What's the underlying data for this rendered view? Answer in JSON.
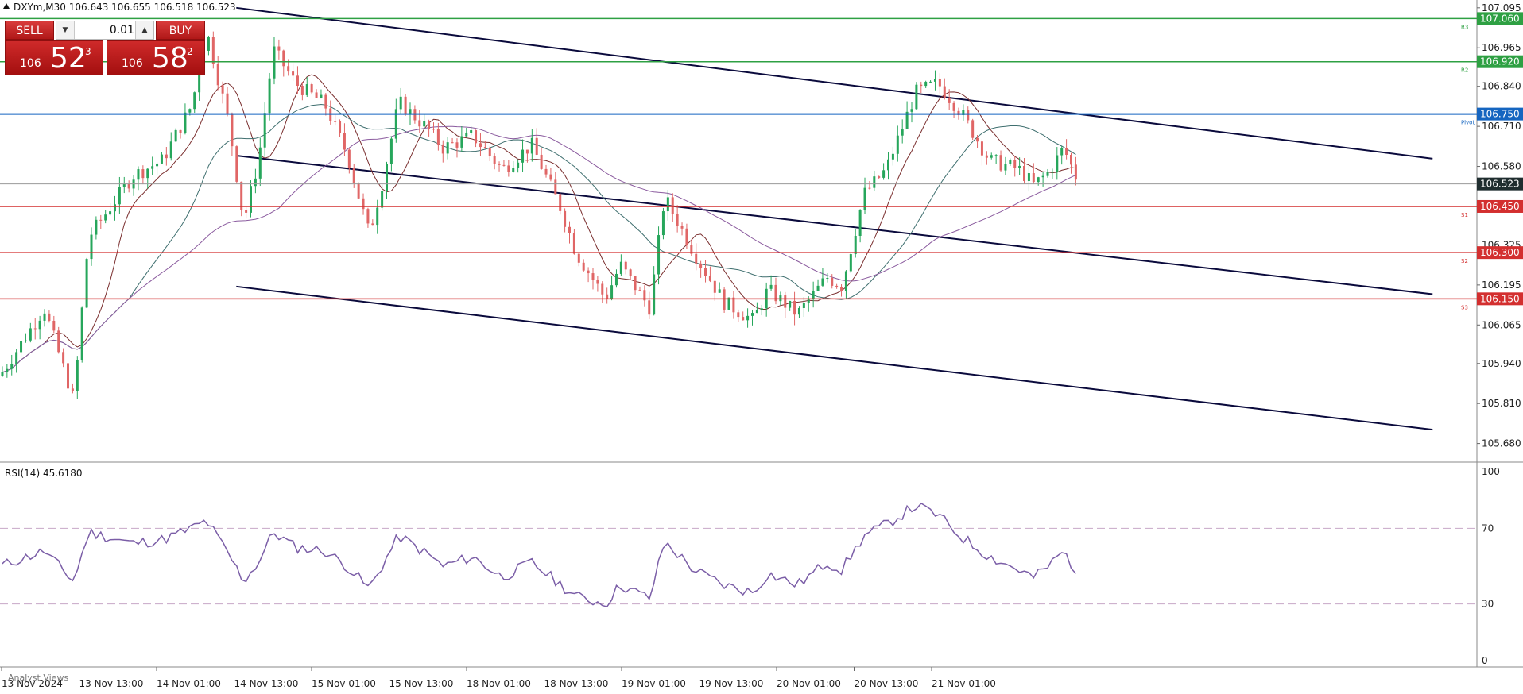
{
  "header": {
    "symbol_text": "DXYm,M30  106.643 106.655 106.518 106.523"
  },
  "trade_panel": {
    "sell_label": "SELL",
    "buy_label": "BUY",
    "lot_value": "0.01",
    "sell_price_small": "106",
    "sell_price_big": "52",
    "sell_price_sup": "3",
    "buy_price_small": "106",
    "buy_price_big": "58",
    "buy_price_sup": "2"
  },
  "colors": {
    "bull": "#26a65b",
    "bear": "#e06666",
    "resistance": "#2ea043",
    "support": "#d32f2f",
    "pivot": "#1565c0",
    "channel": "#0a0a3c",
    "rsi": "#7b5ea7"
  },
  "icons": {
    "sell_decrement": "caret-down-icon",
    "lot_increment": "caret-up-icon",
    "symbol_marker": "triangle-up-icon"
  },
  "chart_data": [
    {
      "type": "candlestick",
      "price_axis": {
        "ticks": [
          "107.095",
          "106.965",
          "106.840",
          "106.710",
          "106.580",
          "106.325",
          "106.195",
          "106.065",
          "105.940",
          "105.810",
          "105.680"
        ],
        "ylim": [
          105.63,
          107.11
        ]
      },
      "x_labels": [
        "13 Nov 2024",
        "13 Nov 13:00",
        "14 Nov 01:00",
        "14 Nov 13:00",
        "15 Nov 01:00",
        "15 Nov 13:00",
        "18 Nov 01:00",
        "18 Nov 13:00",
        "19 Nov 01:00",
        "19 Nov 13:00",
        "20 Nov 01:00",
        "20 Nov 13:00",
        "21 Nov 01:00"
      ],
      "levels": [
        {
          "label": "R3",
          "price": 107.06,
          "price_label": "107.060",
          "role": "resistance"
        },
        {
          "label": "R2",
          "price": 106.92,
          "price_label": "106.920",
          "role": "resistance"
        },
        {
          "label": "Pivot",
          "price": 106.75,
          "price_label": "106.750",
          "role": "pivot"
        },
        {
          "label": "S1",
          "price": 106.45,
          "price_label": "106.450",
          "role": "support"
        },
        {
          "label": "S2",
          "price": 106.3,
          "price_label": "106.300",
          "role": "support"
        },
        {
          "label": "S3",
          "price": 106.15,
          "price_label": "106.150",
          "role": "support"
        }
      ],
      "current_price": {
        "price": 106.523,
        "label": "106.523"
      },
      "channel_lines": [
        {
          "x0_bar": 0.16,
          "y0": 107.095,
          "x1_bar": 0.97,
          "y1": 106.605
        },
        {
          "x0_bar": 0.16,
          "y0": 106.615,
          "x1_bar": 0.97,
          "y1": 106.165
        },
        {
          "x0_bar": 0.16,
          "y0": 106.19,
          "x1_bar": 0.97,
          "y1": 105.725
        }
      ],
      "waypoints": [
        [
          0,
          105.9
        ],
        [
          0.03,
          106.12
        ],
        [
          0.05,
          105.82
        ],
        [
          0.06,
          106.35
        ],
        [
          0.09,
          106.55
        ],
        [
          0.11,
          106.6
        ],
        [
          0.13,
          106.78
        ],
        [
          0.14,
          107.02
        ],
        [
          0.155,
          106.72
        ],
        [
          0.165,
          106.4
        ],
        [
          0.175,
          106.6
        ],
        [
          0.185,
          106.96
        ],
        [
          0.2,
          106.85
        ],
        [
          0.22,
          106.78
        ],
        [
          0.235,
          106.62
        ],
        [
          0.25,
          106.36
        ],
        [
          0.26,
          106.55
        ],
        [
          0.27,
          106.79
        ],
        [
          0.29,
          106.7
        ],
        [
          0.3,
          106.64
        ],
        [
          0.32,
          106.68
        ],
        [
          0.34,
          106.57
        ],
        [
          0.36,
          106.65
        ],
        [
          0.38,
          106.44
        ],
        [
          0.39,
          106.3
        ],
        [
          0.41,
          106.15
        ],
        [
          0.42,
          106.26
        ],
        [
          0.44,
          106.12
        ],
        [
          0.45,
          106.48
        ],
        [
          0.47,
          106.3
        ],
        [
          0.49,
          106.14
        ],
        [
          0.51,
          106.08
        ],
        [
          0.52,
          106.18
        ],
        [
          0.54,
          106.1
        ],
        [
          0.56,
          106.22
        ],
        [
          0.57,
          106.19
        ],
        [
          0.585,
          106.49
        ],
        [
          0.6,
          106.57
        ],
        [
          0.62,
          106.82
        ],
        [
          0.635,
          106.85
        ],
        [
          0.65,
          106.76
        ],
        [
          0.67,
          106.6
        ],
        [
          0.69,
          106.57
        ],
        [
          0.7,
          106.52
        ],
        [
          0.71,
          106.56
        ],
        [
          0.72,
          106.64
        ],
        [
          0.73,
          106.53
        ]
      ]
    },
    {
      "type": "line",
      "title": "RSI(14) 45.6180",
      "ylim": [
        0,
        100
      ],
      "ticks": [
        "100",
        "70",
        "30",
        "0"
      ],
      "levels": [
        70,
        30
      ],
      "waypoints": [
        [
          0,
          50
        ],
        [
          0.03,
          58
        ],
        [
          0.05,
          42
        ],
        [
          0.06,
          68
        ],
        [
          0.09,
          62
        ],
        [
          0.11,
          64
        ],
        [
          0.13,
          70
        ],
        [
          0.14,
          74
        ],
        [
          0.155,
          56
        ],
        [
          0.165,
          42
        ],
        [
          0.175,
          52
        ],
        [
          0.185,
          68
        ],
        [
          0.2,
          60
        ],
        [
          0.22,
          58
        ],
        [
          0.235,
          50
        ],
        [
          0.25,
          38
        ],
        [
          0.26,
          52
        ],
        [
          0.27,
          66
        ],
        [
          0.29,
          56
        ],
        [
          0.3,
          50
        ],
        [
          0.32,
          55
        ],
        [
          0.34,
          44
        ],
        [
          0.36,
          52
        ],
        [
          0.38,
          40
        ],
        [
          0.39,
          34
        ],
        [
          0.41,
          30
        ],
        [
          0.42,
          40
        ],
        [
          0.44,
          33
        ],
        [
          0.45,
          63
        ],
        [
          0.47,
          48
        ],
        [
          0.49,
          40
        ],
        [
          0.51,
          36
        ],
        [
          0.52,
          46
        ],
        [
          0.54,
          40
        ],
        [
          0.56,
          52
        ],
        [
          0.57,
          48
        ],
        [
          0.585,
          66
        ],
        [
          0.6,
          72
        ],
        [
          0.62,
          82
        ],
        [
          0.635,
          77
        ],
        [
          0.65,
          66
        ],
        [
          0.67,
          55
        ],
        [
          0.69,
          48
        ],
        [
          0.7,
          44
        ],
        [
          0.71,
          50
        ],
        [
          0.72,
          58
        ],
        [
          0.73,
          45.6
        ]
      ],
      "footer_label": "Analyst Views"
    }
  ]
}
